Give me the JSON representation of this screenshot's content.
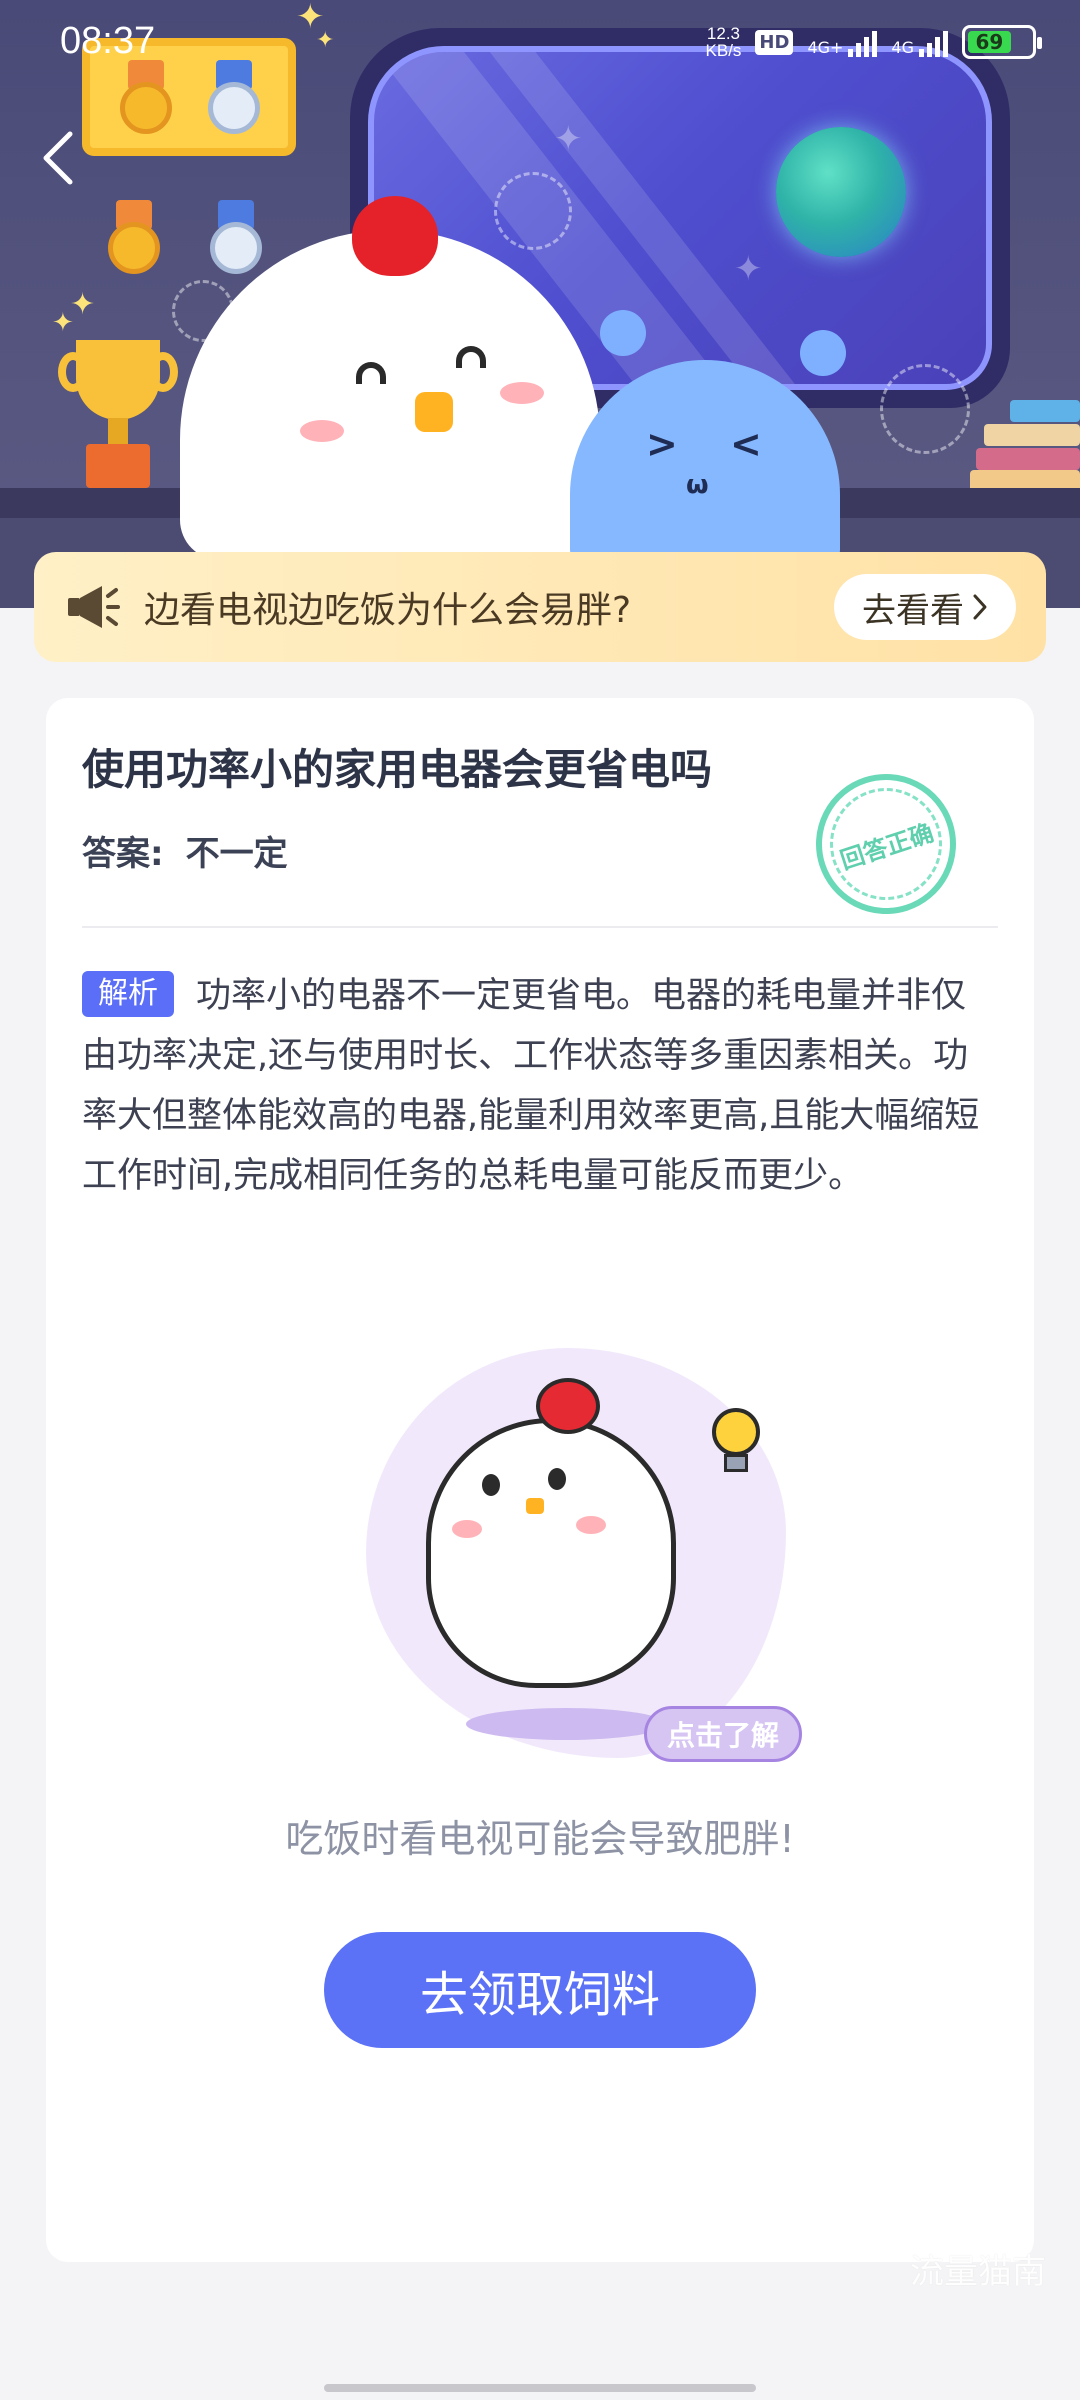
{
  "status_bar": {
    "time": "08:37",
    "net_speed_value": "12.3",
    "net_speed_unit": "KB/s",
    "hd_label": "HD",
    "signal_1_label": "4G+",
    "signal_2_label": "4G",
    "battery_level": "69"
  },
  "notice": {
    "text": "边看电视边吃饭为什么会易胖?",
    "button_label": "去看看"
  },
  "question": {
    "title": "使用功率小的家用电器会更省电吗",
    "answer_label": "答案:",
    "answer_value": "不一定",
    "stamp_text": "回答正确"
  },
  "analysis": {
    "tag": "解析",
    "text": "功率小的电器不一定更省电。电器的耗电量并非仅由功率决定,还与使用时长、工作状态等多重因素相关。功率大但整体能效高的电器,能量利用效率更高,且能大幅缩短工作时间,完成相同任务的总耗电量可能反而更少。"
  },
  "illustration": {
    "badge_label": "点击了解"
  },
  "tip": {
    "text": "吃饭时看电视可能会导致肥胖!"
  },
  "cta": {
    "label": "去领取饲料"
  },
  "watermark": "流量猫南"
}
